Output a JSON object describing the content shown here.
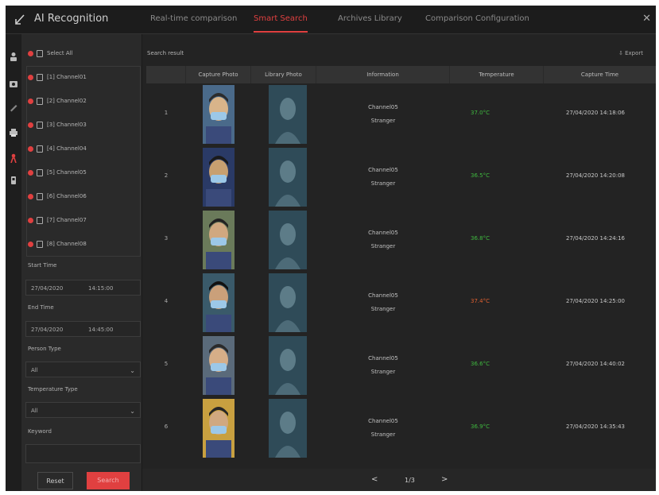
{
  "app": {
    "title": "AI Recognition"
  },
  "tabs": [
    {
      "label": "Real-time comparison",
      "active": false
    },
    {
      "label": "Smart Search",
      "active": true
    },
    {
      "label": "Archives Library",
      "active": false
    },
    {
      "label": "Comparison Configuration",
      "active": false
    }
  ],
  "sidebar": {
    "select_all": "Select All",
    "channels": [
      "[1] Channel01",
      "[2] Channel02",
      "[3] Channel03",
      "[4] Channel04",
      "[5] Channel05",
      "[6] Channel06",
      "[7] Channel07",
      "[8] Channel08"
    ],
    "start_time_label": "Start Time",
    "start_date": "27/04/2020",
    "start_time": "14:15:00",
    "end_time_label": "End Time",
    "end_date": "27/04/2020",
    "end_time": "14:45:00",
    "person_type_label": "Person Type",
    "person_type_value": "All",
    "temperature_type_label": "Temperature Type",
    "temperature_type_value": "All",
    "keyword_label": "Keyword",
    "keyword_value": "",
    "reset_label": "Reset",
    "search_label": "Search"
  },
  "main": {
    "search_result_label": "Search result",
    "export_label": "Export",
    "columns": [
      "",
      "Capture Photo",
      "Library Photo",
      "Information",
      "Temperature",
      "Capture Time"
    ],
    "rows": [
      {
        "index": "1",
        "channel": "Channel05",
        "type": "Stranger",
        "temperature": "37.0°C",
        "temp_status": "normal",
        "time": "27/04/2020 14:18:06"
      },
      {
        "index": "2",
        "channel": "Channel05",
        "type": "Stranger",
        "temperature": "36.5°C",
        "temp_status": "normal",
        "time": "27/04/2020 14:20:08"
      },
      {
        "index": "3",
        "channel": "Channel05",
        "type": "Stranger",
        "temperature": "36.8°C",
        "temp_status": "normal",
        "time": "27/04/2020 14:24:16"
      },
      {
        "index": "4",
        "channel": "Channel05",
        "type": "Stranger",
        "temperature": "37.4°C",
        "temp_status": "high",
        "time": "27/04/2020 14:25:00"
      },
      {
        "index": "5",
        "channel": "Channel05",
        "type": "Stranger",
        "temperature": "36.6°C",
        "temp_status": "normal",
        "time": "27/04/2020 14:40:02"
      },
      {
        "index": "6",
        "channel": "Channel05",
        "type": "Stranger",
        "temperature": "36.9°C",
        "temp_status": "normal",
        "time": "27/04/2020 14:35:43"
      }
    ],
    "pager": {
      "prev": "<",
      "page": "1/3",
      "next": ">"
    }
  },
  "colors": {
    "accent": "#e04040",
    "normal_temp": "#3fb93f",
    "high_temp": "#e06030",
    "bg": "#262626"
  },
  "icons": [
    "back-icon",
    "person-icon",
    "camera-icon",
    "pen-icon",
    "printer-icon",
    "face-recognition-icon",
    "device-icon",
    "close-icon",
    "export-icon"
  ]
}
